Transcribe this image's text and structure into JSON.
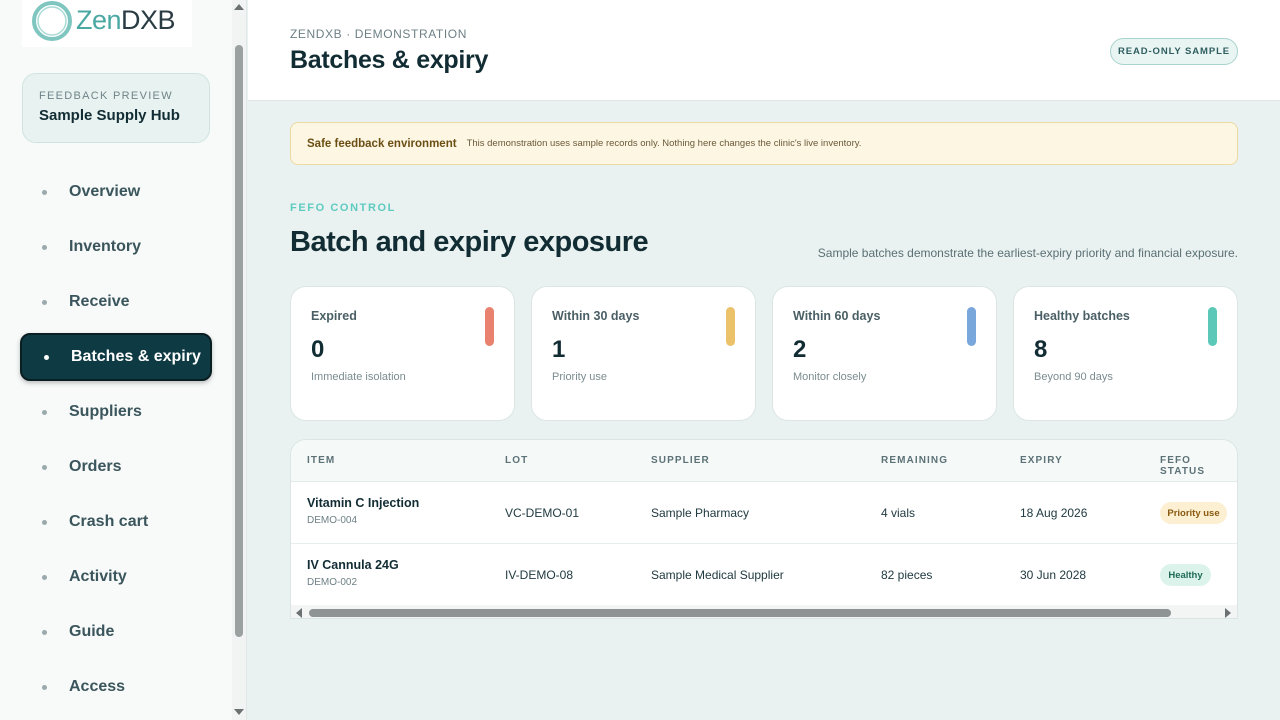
{
  "logo": {
    "text_zen": "Zen",
    "text_rest": "DXB"
  },
  "hub": {
    "eyebrow": "FEEDBACK PREVIEW",
    "title": "Sample Supply Hub"
  },
  "nav": {
    "items": [
      {
        "label": "Overview",
        "active": false
      },
      {
        "label": "Inventory",
        "active": false
      },
      {
        "label": "Receive",
        "active": false
      },
      {
        "label": "Batches & expiry",
        "active": true
      },
      {
        "label": "Suppliers",
        "active": false
      },
      {
        "label": "Orders",
        "active": false
      },
      {
        "label": "Crash cart",
        "active": false
      },
      {
        "label": "Activity",
        "active": false
      },
      {
        "label": "Guide",
        "active": false
      },
      {
        "label": "Access",
        "active": false
      }
    ]
  },
  "header": {
    "breadcrumb": "ZENDXB · DEMONSTRATION",
    "title": "Batches & expiry",
    "badge": "READ-ONLY SAMPLE"
  },
  "notice": {
    "title": "Safe feedback environment",
    "text": "This demonstration uses sample records only. Nothing here changes the clinic's live inventory."
  },
  "section": {
    "eyebrow": "FEFO CONTROL",
    "title": "Batch and expiry exposure",
    "subtitle": "Sample batches demonstrate the earliest-expiry priority and financial exposure."
  },
  "cards": [
    {
      "label": "Expired",
      "value": "0",
      "caption": "Immediate isolation",
      "color": "#e8826f"
    },
    {
      "label": "Within 30 days",
      "value": "1",
      "caption": "Priority use",
      "color": "#ebc26a"
    },
    {
      "label": "Within 60 days",
      "value": "2",
      "caption": "Monitor closely",
      "color": "#79a7dc"
    },
    {
      "label": "Healthy batches",
      "value": "8",
      "caption": "Beyond 90 days",
      "color": "#5cc8b8"
    }
  ],
  "table": {
    "columns": [
      "ITEM",
      "LOT",
      "SUPPLIER",
      "REMAINING",
      "EXPIRY",
      "FEFO STATUS"
    ],
    "rows": [
      {
        "item": "Vitamin C Injection",
        "code": "DEMO-004",
        "lot": "VC-DEMO-01",
        "supplier": "Sample Pharmacy",
        "remaining": "4 vials",
        "expiry": "18 Aug 2026",
        "status": "Priority use"
      },
      {
        "item": "IV Cannula 24G",
        "code": "DEMO-002",
        "lot": "IV-DEMO-08",
        "supplier": "Sample Medical Supplier",
        "remaining": "82 pieces",
        "expiry": "30 Jun 2028",
        "status": "Healthy"
      }
    ]
  },
  "colors": {
    "accent": "#5ecbc1",
    "nav_active_bg": "#0e3a43",
    "priority_bg": "#fcefd2",
    "priority_fg": "#8a5a10",
    "healthy_bg": "#dcf3ec",
    "healthy_fg": "#1e6a55"
  }
}
